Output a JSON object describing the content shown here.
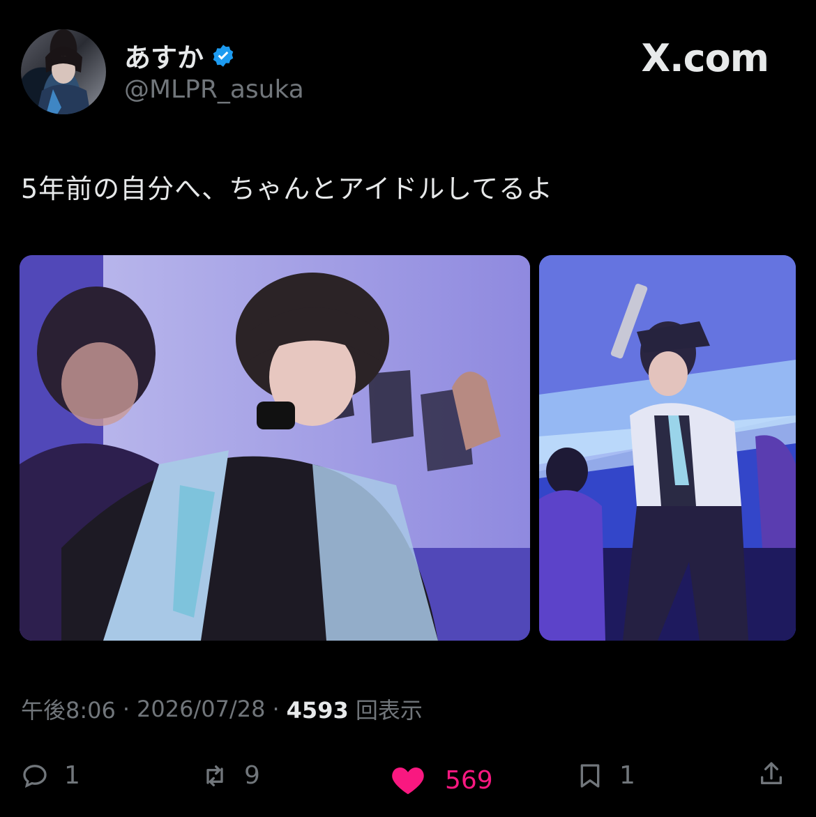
{
  "header": {
    "display_name": "あすか",
    "handle": "@MLPR_asuka",
    "verified": true,
    "site_label": "X.com"
  },
  "tweet": {
    "text": "5年前の自分へ、ちゃんとアイドルしてるよ",
    "time": "午後8:06",
    "date": "2026/07/28",
    "separator": "·",
    "views_count": "4593",
    "views_label": "回表示"
  },
  "actions": {
    "reply_count": "1",
    "retweet_count": "9",
    "like_count": "569",
    "bookmark_count": "1"
  },
  "icons": {
    "reply": "reply-icon",
    "retweet": "retweet-icon",
    "like": "heart-icon",
    "bookmark": "bookmark-icon",
    "share": "share-icon",
    "verified": "verified-badge-icon"
  },
  "colors": {
    "background": "#000000",
    "text": "#e7e9ea",
    "muted": "#71767b",
    "like": "#f91880",
    "verified": "#1d9bf0"
  }
}
